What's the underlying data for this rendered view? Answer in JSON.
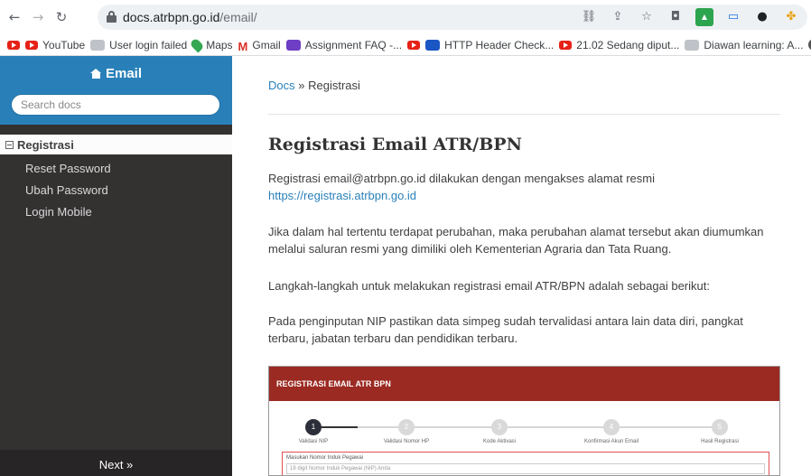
{
  "browser": {
    "url_host": "docs.atrbpn.go.id",
    "url_path": "/email/",
    "bookmarks": [
      {
        "label": "",
        "icon": "youtube-icon"
      },
      {
        "label": "YouTube",
        "icon": "youtube-icon"
      },
      {
        "label": "User login failed",
        "icon": "page-icon"
      },
      {
        "label": "Maps",
        "icon": "maps-icon"
      },
      {
        "label": "Gmail",
        "icon": "gmail-icon"
      },
      {
        "label": "Assignment FAQ -...",
        "icon": "app-icon"
      },
      {
        "label": "",
        "icon": "youtube-icon"
      },
      {
        "label": "HTTP Header Check...",
        "icon": "tool-icon"
      },
      {
        "label": "21.02 Sedang diput...",
        "icon": "youtube-icon"
      },
      {
        "label": "Diawan learning: A...",
        "icon": "page-icon"
      },
      {
        "label": "",
        "icon": "globe-icon"
      }
    ]
  },
  "sidebar": {
    "title": "Email",
    "search_placeholder": "Search docs",
    "current": "Registrasi",
    "items": [
      "Reset Password",
      "Ubah Password",
      "Login Mobile"
    ],
    "next": "Next »"
  },
  "content": {
    "breadcrumb_home": "Docs",
    "breadcrumb_sep": " » ",
    "breadcrumb_current": "Registrasi",
    "heading": "Registrasi Email ATR/BPN",
    "p1_text": "Registrasi email@atrbpn.go.id dilakukan dengan mengakses alamat resmi",
    "p1_link": "https://registrasi.atrbpn.go.id",
    "p2": "Jika dalam hal tertentu terdapat perubahan, maka perubahan alamat tersebut akan diumumkan melalui saluran resmi yang dimiliki oleh Kementerian Agraria dan Tata Ruang.",
    "p3": "Langkah-langkah untuk melakukan registrasi email ATR/BPN adalah sebagai berikut:",
    "p4": "Pada penginputan NIP pastikan data simpeg sudah tervalidasi antara lain data diri, pangkat terbaru, jabatan terbaru dan pendidikan terbaru."
  },
  "screenshot": {
    "header": "REGISTRASI EMAIL ATR BPN",
    "steps": [
      {
        "num": "1",
        "label": "Validasi NIP"
      },
      {
        "num": "2",
        "label": "Validasi Nomor HP"
      },
      {
        "num": "3",
        "label": "Kode Aktivasi"
      },
      {
        "num": "4",
        "label": "Konfirmasi Akun Email"
      },
      {
        "num": "5",
        "label": "Hasil Registrasi"
      }
    ],
    "field_label": "Masukan Nomor Induk Pegawai",
    "field_placeholder": "18 digit Nomor Induk Pegawai (NIP) Anda"
  }
}
